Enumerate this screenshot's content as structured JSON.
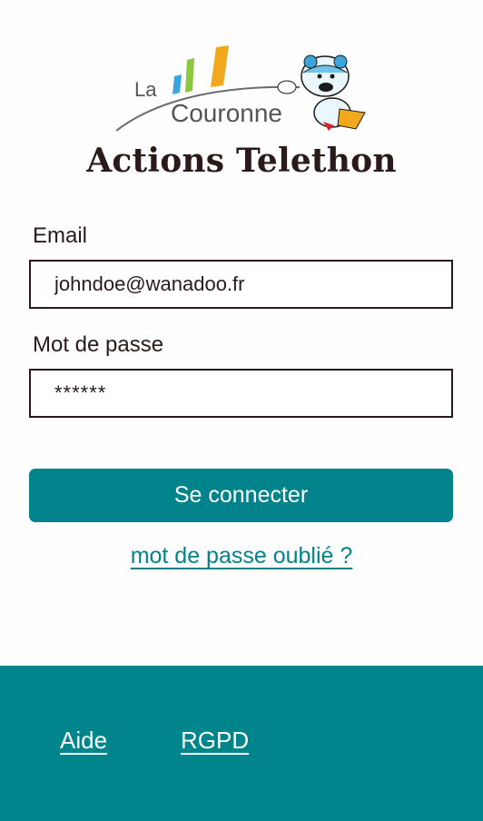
{
  "logo": {
    "word_small": "La",
    "word_main": "Couronne",
    "colors": [
      "#3aa6dc",
      "#8dc63f",
      "#f2a81d"
    ]
  },
  "app_title": "Actions Telethon",
  "form": {
    "email_label": "Email",
    "email_value": "johndoe@wanadoo.fr",
    "password_label": "Mot de passe",
    "password_value": "******",
    "submit_label": "Se connecter",
    "forgot_label": "mot de passe oublié ?"
  },
  "footer": {
    "links": [
      "Aide",
      "RGPD"
    ]
  },
  "colors": {
    "primary": "#00838b",
    "text": "#2a1a1a",
    "background": "#fefefe"
  }
}
